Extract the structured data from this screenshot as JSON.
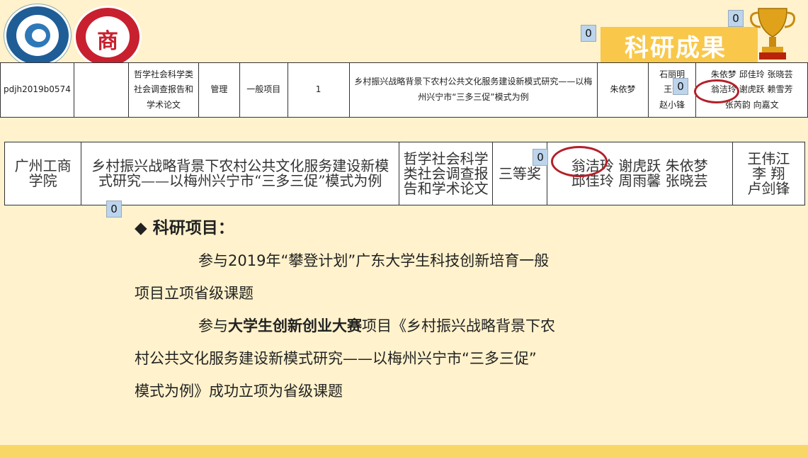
{
  "title": "科研成果",
  "badges": [
    "0",
    "0",
    "0",
    "0",
    "0"
  ],
  "table1": {
    "cells": [
      "pdjh2019b0574",
      "",
      "哲学社会科学类社会调查报告和学术论文",
      "管理",
      "一般项目",
      "1",
      "乡村振兴战略背景下农村公共文化服务建设新模式研究——以梅州兴宁市“三多三促”模式为例",
      "朱依梦"
    ],
    "advisors": [
      "石丽明",
      "王伟",
      "赵小锋"
    ],
    "members_line1": "朱依梦  邱佳玲  张晓芸",
    "members_line2": "翁洁玲  谢虎跃  赖雪芳",
    "members_line3": "张芮韵  向嘉文"
  },
  "table2": {
    "school": "广州工商学院",
    "project": "乡村振兴战略背景下农村公共文化服务建设新模式研究——以梅州兴宁市“三多三促”模式为例",
    "category": "哲学社会科学类社会调查报告和学术论文",
    "award": "三等奖",
    "members_line1": "翁洁玲  谢虎跃  朱依梦",
    "members_line2": "邱佳玲  周雨馨  张晓芸",
    "advisors": [
      "王伟江",
      "李 翔",
      "卢剑锋"
    ]
  },
  "section": {
    "heading": "◆ 科研项目：",
    "p1": "参与2019年“攀登计划”广东大学生科技创新培育一般",
    "p1b": "项目立项省级课题",
    "p2_pre": "参与",
    "p2_bold": "大学生创新创业大赛",
    "p2_post": "项目《乡村振兴战略背景下农",
    "p2b": "村公共文化服务建设新模式研究——以梅州兴宁市“三多三促”",
    "p2c": "模式为例》成功立项为省级课题"
  }
}
